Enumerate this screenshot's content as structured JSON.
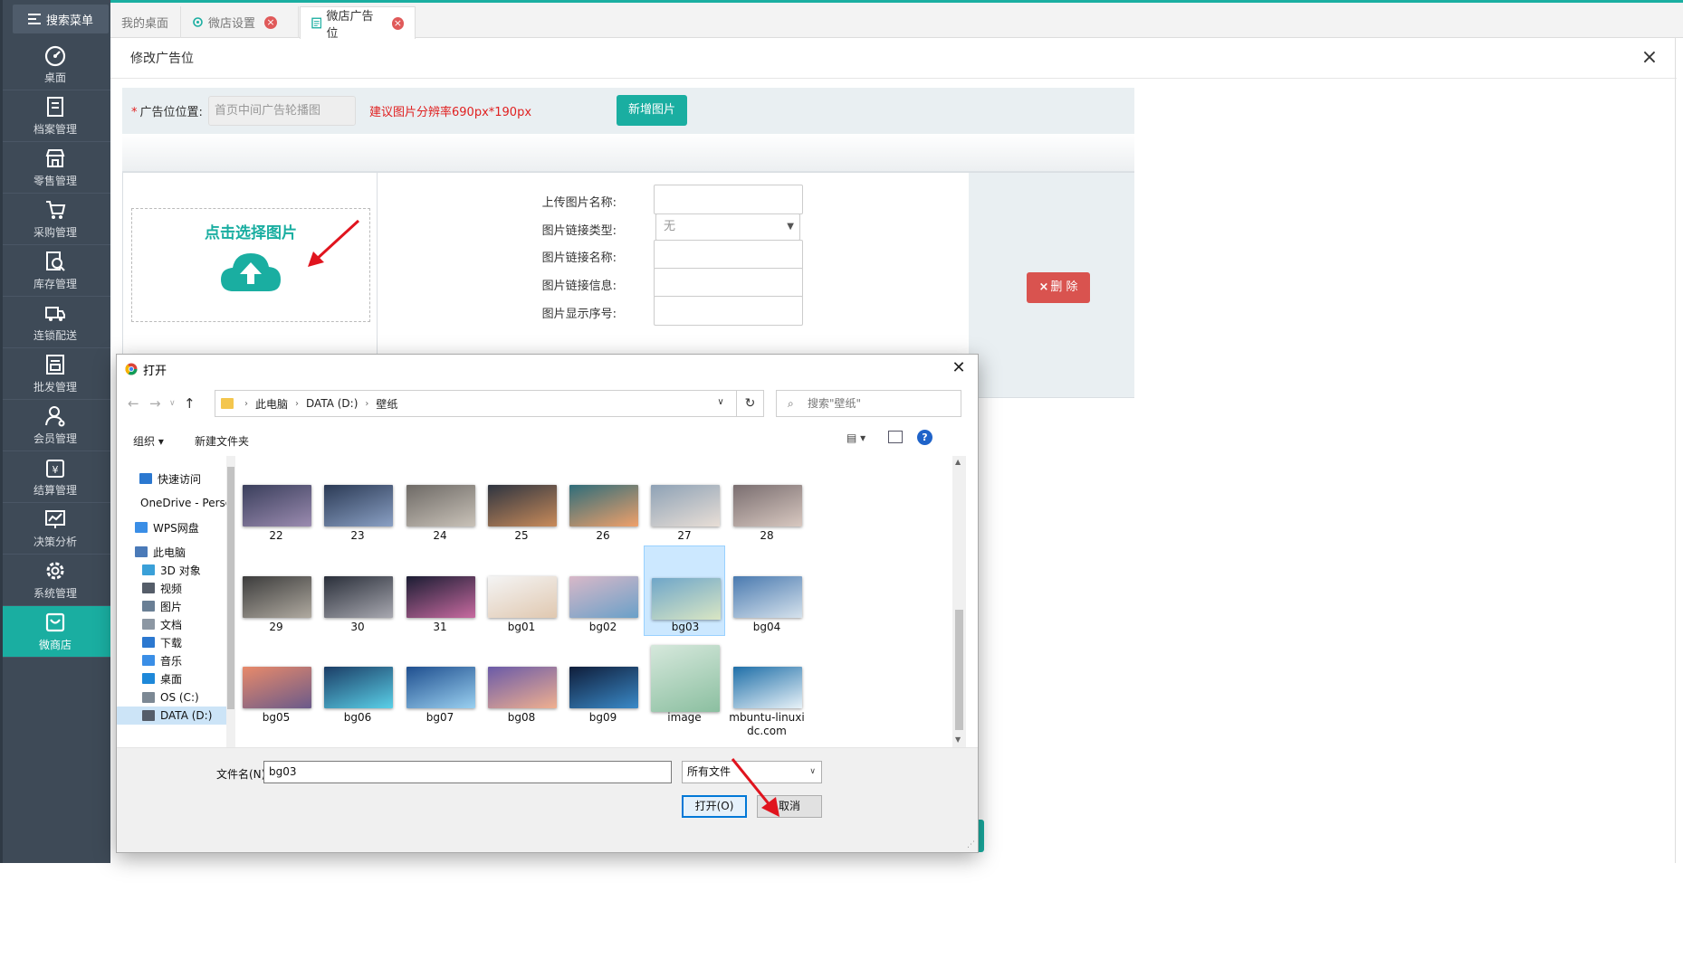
{
  "sidebar": {
    "search_label": "搜索菜单",
    "items": [
      {
        "label": "桌面",
        "icon": "dashboard-icon"
      },
      {
        "label": "档案管理",
        "icon": "archive-icon"
      },
      {
        "label": "零售管理",
        "icon": "store-icon"
      },
      {
        "label": "采购管理",
        "icon": "cart-icon"
      },
      {
        "label": "库存管理",
        "icon": "inventory-icon"
      },
      {
        "label": "连锁配送",
        "icon": "truck-icon"
      },
      {
        "label": "批发管理",
        "icon": "wholesale-icon"
      },
      {
        "label": "会员管理",
        "icon": "member-icon"
      },
      {
        "label": "结算管理",
        "icon": "settlement-icon"
      },
      {
        "label": "决策分析",
        "icon": "analysis-icon"
      },
      {
        "label": "系统管理",
        "icon": "gear-icon"
      },
      {
        "label": "微商店",
        "icon": "shop-bag-icon",
        "active": true
      }
    ]
  },
  "tabs": [
    {
      "label": "我的桌面"
    },
    {
      "label": "微店设置"
    },
    {
      "label": "微店广告位",
      "active": true
    }
  ],
  "panel": {
    "title": "修改广告位",
    "position_label": "广告位位置:",
    "position_value": "首页中间广告轮播图",
    "size_hint": "建议图片分辨率690px*190px",
    "add_image_button": "新增图片",
    "picker_label": "点击选择图片",
    "fields": {
      "name_label": "上传图片名称:",
      "link_type_label": "图片链接类型:",
      "link_type_value": "无",
      "link_name_label": "图片链接名称:",
      "link_info_label": "图片链接信息:",
      "order_label": "图片显示序号:"
    },
    "delete_button": "删 除"
  },
  "dialog": {
    "title": "打开",
    "path": [
      "此电脑",
      "DATA (D:)",
      "壁纸"
    ],
    "search_placeholder": "搜索\"壁纸\"",
    "toolbar": {
      "organize": "组织 ▾",
      "new_folder": "新建文件夹",
      "help": "?"
    },
    "tree": [
      {
        "label": "快速访问",
        "color": "#2b78d0"
      },
      {
        "label": "OneDrive - Perso",
        "color": "#1e6fd9"
      },
      {
        "label": "WPS网盘",
        "color": "#3a8ee6"
      },
      {
        "label": "此电脑",
        "color": "#4a7ab8"
      },
      {
        "label": "3D 对象",
        "color": "#3aa0d8"
      },
      {
        "label": "视频",
        "color": "#555d69"
      },
      {
        "label": "图片",
        "color": "#6a7f95"
      },
      {
        "label": "文档",
        "color": "#8c97a3"
      },
      {
        "label": "下载",
        "color": "#2b78d0"
      },
      {
        "label": "音乐",
        "color": "#3a8ee6"
      },
      {
        "label": "桌面",
        "color": "#1e88d9"
      },
      {
        "label": "OS (C:)",
        "color": "#7c8894"
      },
      {
        "label": "DATA (D:)",
        "color": "#555d69",
        "selected": true
      }
    ],
    "files": [
      {
        "name": "22",
        "c1": "#3a3f5c",
        "c2": "#9b8bb0"
      },
      {
        "name": "23",
        "c1": "#2b3a55",
        "c2": "#8aa0c4"
      },
      {
        "name": "24",
        "c1": "#6e6a66",
        "c2": "#c9c2b8"
      },
      {
        "name": "25",
        "c1": "#2e3440",
        "c2": "#c98b5a"
      },
      {
        "name": "26",
        "c1": "#2f6d7a",
        "c2": "#f0a06a"
      },
      {
        "name": "27",
        "c1": "#8ea2b6",
        "c2": "#e8ded6"
      },
      {
        "name": "28",
        "c1": "#7a6e70",
        "c2": "#d8c8c0"
      },
      {
        "name": "29",
        "c1": "#3c3c3c",
        "c2": "#b0aaa0"
      },
      {
        "name": "30",
        "c1": "#2a2f3a",
        "c2": "#a8a8b0"
      },
      {
        "name": "31",
        "c1": "#1b1d33",
        "c2": "#c86aa0"
      },
      {
        "name": "bg01",
        "c1": "#f4f4f4",
        "c2": "#e0c8b0"
      },
      {
        "name": "bg02",
        "c1": "#d8b8c8",
        "c2": "#6aa0c8"
      },
      {
        "name": "bg03",
        "c1": "#6fa6c9",
        "c2": "#d9e6c4",
        "selected": true
      },
      {
        "name": "bg04",
        "c1": "#4a7ab0",
        "c2": "#d6e2ec"
      },
      {
        "name": "bg05",
        "c1": "#e88a6a",
        "c2": "#6a5a8a"
      },
      {
        "name": "bg06",
        "c1": "#1b3d66",
        "c2": "#5ad0e8"
      },
      {
        "name": "bg07",
        "c1": "#1f4f8f",
        "c2": "#9ad0f0"
      },
      {
        "name": "bg08",
        "c1": "#6a5aa8",
        "c2": "#f0b090"
      },
      {
        "name": "bg09",
        "c1": "#0f1d3a",
        "c2": "#3a8ac8"
      },
      {
        "name": "image",
        "c1": "#d6e8dc",
        "c2": "#8bbfa0",
        "tall": true
      },
      {
        "name": "mbuntu-linuxidc.com",
        "c1": "#1f6fa8",
        "c2": "#e8f2f8"
      }
    ],
    "filename_label": "文件名(N):",
    "filename_value": "bg03",
    "filter_value": "所有文件",
    "open_button": "打开(O)",
    "cancel_button": "取消"
  },
  "colors": {
    "accent": "#1aaea1",
    "danger": "#d9534f",
    "sidebar_bg": "#3e4a57",
    "hint_red": "#e02020",
    "annotation_red": "#e0141e"
  }
}
